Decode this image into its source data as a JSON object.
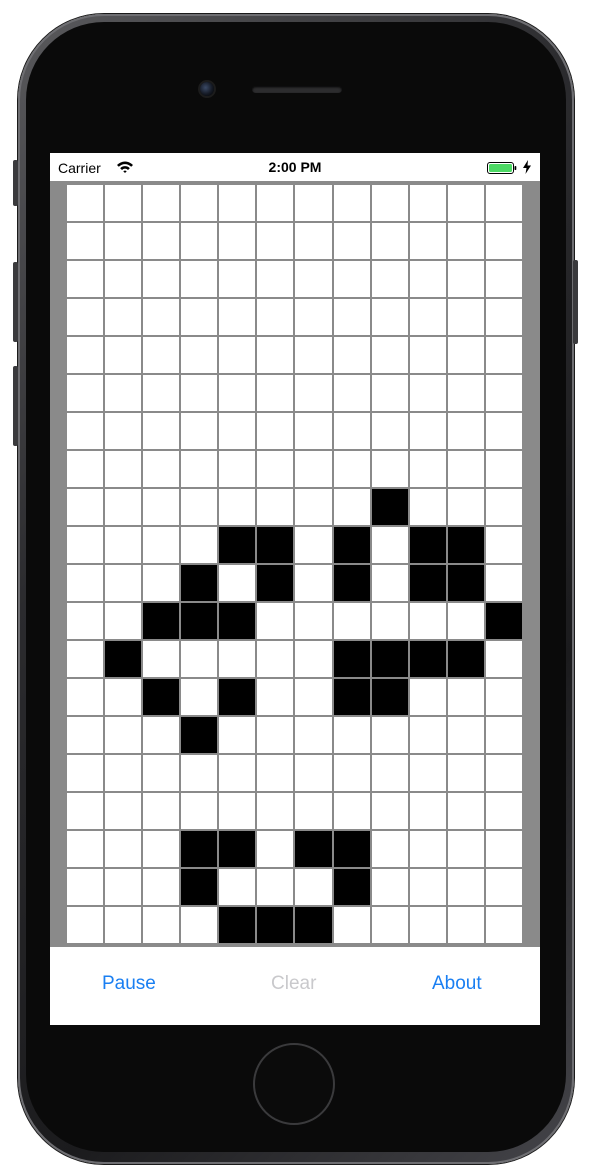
{
  "status_bar": {
    "carrier": "Carrier",
    "time": "2:00 PM",
    "icons": [
      "wifi-icon",
      "battery-icon",
      "charging-icon"
    ],
    "battery_color": "#4cd964"
  },
  "board": {
    "columns": 12,
    "rows": 20,
    "alive_color": "#000000",
    "dead_color": "#ffffff",
    "grid_line_color": "#8a8a8a",
    "alive_cells": [
      [
        8,
        8
      ],
      [
        9,
        4
      ],
      [
        9,
        5
      ],
      [
        9,
        7
      ],
      [
        9,
        9
      ],
      [
        9,
        10
      ],
      [
        10,
        3
      ],
      [
        10,
        5
      ],
      [
        10,
        7
      ],
      [
        10,
        9
      ],
      [
        10,
        10
      ],
      [
        11,
        2
      ],
      [
        11,
        3
      ],
      [
        11,
        4
      ],
      [
        11,
        11
      ],
      [
        12,
        1
      ],
      [
        12,
        7
      ],
      [
        12,
        8
      ],
      [
        12,
        9
      ],
      [
        12,
        10
      ],
      [
        13,
        2
      ],
      [
        13,
        4
      ],
      [
        13,
        7
      ],
      [
        13,
        8
      ],
      [
        14,
        3
      ],
      [
        17,
        3
      ],
      [
        17,
        4
      ],
      [
        17,
        6
      ],
      [
        17,
        7
      ],
      [
        18,
        3
      ],
      [
        18,
        7
      ],
      [
        19,
        4
      ],
      [
        19,
        5
      ],
      [
        19,
        6
      ]
    ]
  },
  "toolbar": {
    "pause_label": "Pause",
    "clear_label": "Clear",
    "about_label": "About",
    "active_color": "#1a7ff2",
    "disabled_color": "#c9c9cc"
  }
}
